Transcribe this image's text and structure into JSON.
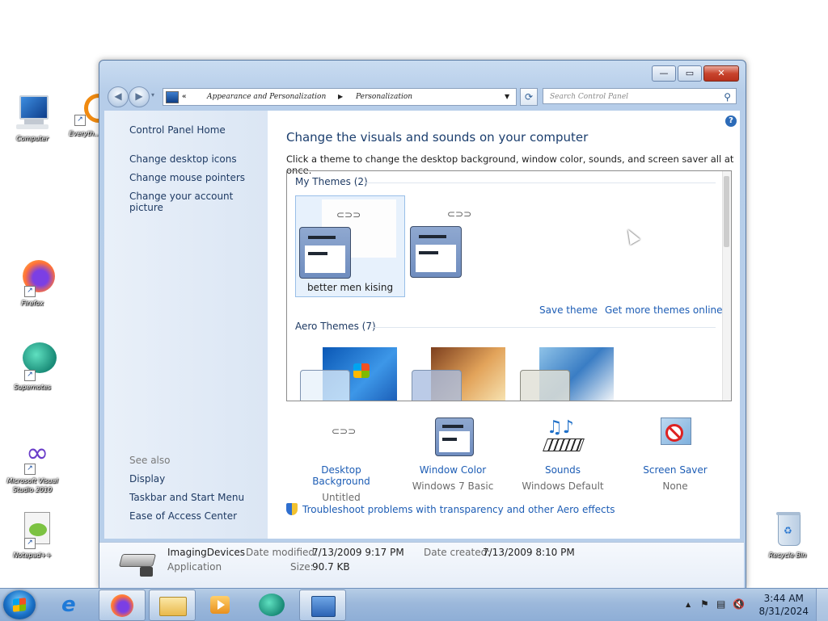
{
  "desktop": {
    "icons": [
      {
        "label": "Computer"
      },
      {
        "label": "Everyth..."
      },
      {
        "label": "Firefox"
      },
      {
        "label": "Supernotes"
      },
      {
        "label": "Microsoft Visual Studio 2010"
      },
      {
        "label": "Notepad++"
      },
      {
        "label": "Recycle Bin"
      }
    ]
  },
  "window": {
    "title_buttons": {
      "minimize": "—",
      "maximize": "▭",
      "close": "✕"
    },
    "breadcrumb": {
      "root": "«",
      "seg1": "Appearance and Personalization",
      "seg2": "Personalization"
    },
    "search_placeholder": "Search Control Panel"
  },
  "left_pane": {
    "links": [
      "Control Panel Home",
      "Change desktop icons",
      "Change mouse pointers",
      "Change your account picture"
    ],
    "see_also_heading": "See also",
    "see_also": [
      "Display",
      "Taskbar and Start Menu",
      "Ease of Access Center"
    ]
  },
  "main": {
    "heading": "Change the visuals and sounds on your computer",
    "subheading": "Click a theme to change the desktop background, window color, sounds, and screen saver all at once.",
    "my_themes_heading": "My Themes (2)",
    "selected_theme_name": "better men kising",
    "save_theme": "Save theme",
    "get_more": "Get more themes online",
    "aero_themes_heading": "Aero Themes (7)",
    "settings": [
      {
        "name": "Desktop Background",
        "value": "Untitled",
        "icon": "desktop-background-icon"
      },
      {
        "name": "Window Color",
        "value": "Windows 7 Basic",
        "icon": "window-color-icon"
      },
      {
        "name": "Sounds",
        "value": "Windows Default",
        "icon": "sounds-icon"
      },
      {
        "name": "Screen Saver",
        "value": "None",
        "icon": "screen-saver-icon"
      }
    ],
    "troubleshoot": "Troubleshoot problems with transparency and other Aero effects"
  },
  "details_pane": {
    "name": "ImagingDevices",
    "type": "Application",
    "modified_label": "Date modified:",
    "modified": "7/13/2009 9:17 PM",
    "size_label": "Size:",
    "size": "90.7 KB",
    "created_label": "Date created:",
    "created": "7/13/2009 8:10 PM"
  },
  "taskbar": {
    "time": "3:44 AM",
    "date": "8/31/2024",
    "tray_expand": "▲"
  },
  "colors": {
    "link": "#1d5db5",
    "heading": "#1b3e6e",
    "taskbar": "#9cb8db"
  }
}
